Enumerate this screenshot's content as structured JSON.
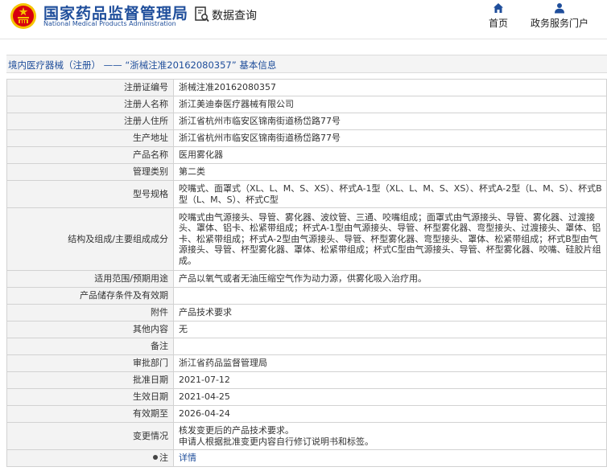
{
  "header": {
    "site_name_cn": "国家药品监督管理局",
    "site_name_en": "National Medical Products Administration",
    "data_query": "数据查询",
    "nav": [
      {
        "label": "首页",
        "icon": "home-icon"
      },
      {
        "label": "政务服务门户",
        "icon": "person-icon"
      }
    ]
  },
  "breadcrumb": {
    "category": "境内医疗器械（注册）",
    "separator": "——",
    "title": "“浙械注准20162080357” 基本信息"
  },
  "details": [
    {
      "key": "注册证编号",
      "value": "浙械注准20162080357"
    },
    {
      "key": "注册人名称",
      "value": "浙江美迪泰医疗器械有限公司"
    },
    {
      "key": "注册人住所",
      "value": "浙江省杭州市临安区锦南街道杨岱路77号"
    },
    {
      "key": "生产地址",
      "value": "浙江省杭州市临安区锦南街道杨岱路77号"
    },
    {
      "key": "产品名称",
      "value": "医用雾化器"
    },
    {
      "key": "管理类别",
      "value": "第二类"
    },
    {
      "key": "型号规格",
      "value": "咬嘴式、面罩式（XL、L、M、S、XS）、杯式A-1型（XL、L、M、S、XS）、杯式A-2型（L、M、S）、杯式B型（L、M、S）、杯式C型"
    },
    {
      "key": "结构及组成/主要组成成分",
      "value": "咬嘴式由气源接头、导管、雾化器、波纹管、三通、咬嘴组成；面罩式由气源接头、导管、雾化器、过渡接头、罩体、铝卡、松紧带组成；杯式A-1型由气源接头、导管、杯型雾化器、弯型接头、过渡接头、罩体、铝卡、松紧带组成；杯式A-2型由气源接头、导管、杯型雾化器、弯型接头、罩体、松紧带组成；杯式B型由气源接头、导管、杯型雾化器、罩体、松紧带组成；杯式C型由气源接头、导管、杯型雾化器、咬嘴、硅胶片组成。"
    },
    {
      "key": "适用范围/预期用途",
      "value": "产品以氧气或者无油压缩空气作为动力源，供雾化吸入治疗用。"
    },
    {
      "key": "产品储存条件及有效期",
      "value": ""
    },
    {
      "key": "附件",
      "value": "产品技术要求"
    },
    {
      "key": "其他内容",
      "value": "无"
    },
    {
      "key": "备注",
      "value": ""
    },
    {
      "key": "审批部门",
      "value": "浙江省药品监督管理局"
    },
    {
      "key": "批准日期",
      "value": "2021-07-12"
    },
    {
      "key": "生效日期",
      "value": "2021-04-25"
    },
    {
      "key": "有效期至",
      "value": "2026-04-24"
    },
    {
      "key": "变更情况",
      "value_lines": [
        "核发变更后的产品技术要求。",
        "申请人根据批准变更内容自行修订说明书和标签。"
      ]
    },
    {
      "key": "注",
      "value": "详情",
      "key_icon": "pin-icon"
    }
  ],
  "colors": {
    "brand_blue": "#1f4e9b",
    "key_bg": "#f3f3f3",
    "border": "#d2d2d2",
    "emblem_red": "#d7000f",
    "emblem_gold": "#f5c400"
  }
}
